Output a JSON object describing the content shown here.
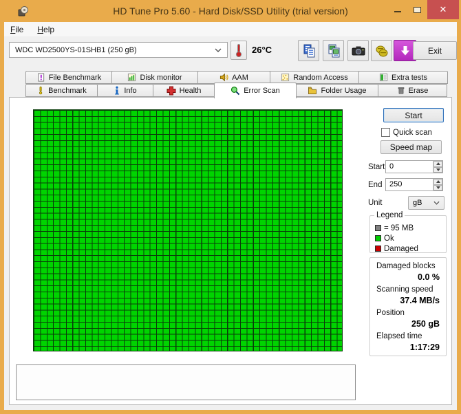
{
  "window": {
    "title": "HD Tune Pro 5.60 - Hard Disk/SSD Utility (trial version)",
    "close_glyph": "✕"
  },
  "menu": {
    "file": "File",
    "help": "Help"
  },
  "toolbar": {
    "drive_selected": "WDC WD2500YS-01SHB1 (250 gB)",
    "temperature": "26°C",
    "exit_label": "Exit",
    "icon_buttons": [
      "thermometer-icon",
      "copy-icon",
      "copy-image-icon",
      "camera-icon",
      "hand-icon",
      "download-icon"
    ]
  },
  "tabs": {
    "row1": [
      {
        "label": "File Benchmark",
        "icon": "file-benchmark-icon",
        "active": false
      },
      {
        "label": "Disk monitor",
        "icon": "disk-monitor-icon",
        "active": false
      },
      {
        "label": "AAM",
        "icon": "aam-icon",
        "active": false
      },
      {
        "label": "Random Access",
        "icon": "random-access-icon",
        "active": false
      },
      {
        "label": "Extra tests",
        "icon": "extra-tests-icon",
        "active": false
      }
    ],
    "row2": [
      {
        "label": "Benchmark",
        "icon": "benchmark-icon",
        "active": false
      },
      {
        "label": "Info",
        "icon": "info-icon",
        "active": false
      },
      {
        "label": "Health",
        "icon": "health-icon",
        "active": false
      },
      {
        "label": "Error Scan",
        "icon": "error-scan-icon",
        "active": true
      },
      {
        "label": "Folder Usage",
        "icon": "folder-usage-icon",
        "active": false
      },
      {
        "label": "Erase",
        "icon": "erase-icon",
        "active": false
      }
    ]
  },
  "error_scan": {
    "start_button": "Start",
    "quick_scan_label": "Quick scan",
    "quick_scan_checked": false,
    "speed_map_button": "Speed map",
    "start_label": "Start",
    "start_value": "0",
    "end_label": "End",
    "end_value": "250",
    "unit_label": "Unit",
    "unit_value": "gB"
  },
  "legend": {
    "title": "Legend",
    "items": [
      {
        "label": "= 95 MB",
        "color": "#808080"
      },
      {
        "label": "Ok",
        "color": "#00CC00"
      },
      {
        "label": "Damaged",
        "color": "#CC0000"
      }
    ]
  },
  "status": {
    "rows": [
      {
        "label": "Damaged blocks",
        "value": "0.0 %"
      },
      {
        "label": "Scanning speed",
        "value": "37.4 MB/s"
      },
      {
        "label": "Position",
        "value": "250 gB"
      },
      {
        "label": "Elapsed time",
        "value": "1:17:29"
      }
    ]
  },
  "grid": {
    "columns": 48,
    "rows": 40,
    "blocks_state": "all Ok",
    "ok_color": "#00D400",
    "line_color": "#0A3C0A"
  },
  "colors": {
    "titlebar": "#E9AB4B",
    "close_button": "#C75050",
    "focus_border": "#3070B8",
    "download_button": "#B227BC"
  }
}
